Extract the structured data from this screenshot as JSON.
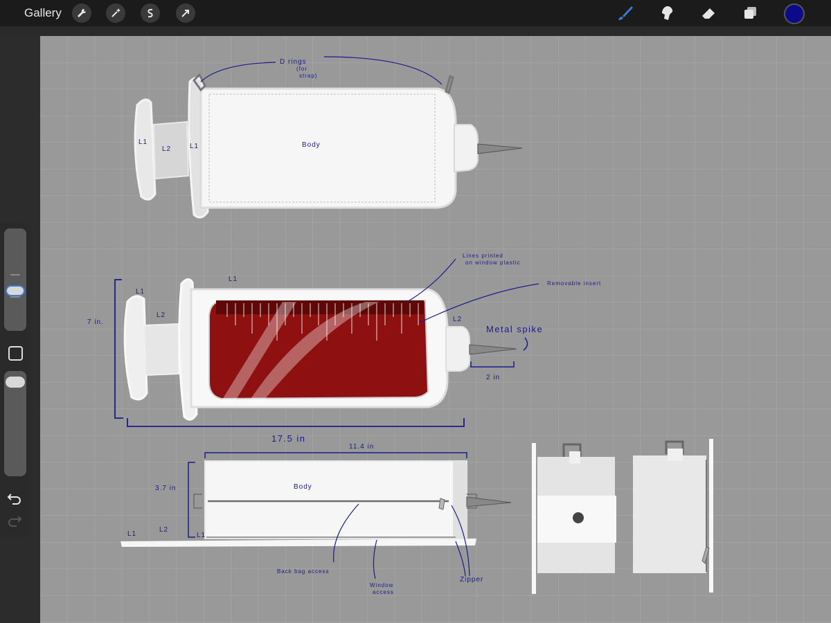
{
  "toolbar": {
    "gallery_label": "Gallery",
    "left_tools": [
      "wrench-icon",
      "magic-wand-icon",
      "selection-icon",
      "transform-arrow-icon"
    ],
    "right_tools": [
      "brush-icon",
      "smudge-icon",
      "eraser-icon",
      "layers-icon"
    ],
    "brush_active_color": "#3a7bd5",
    "current_color": "#0a0a8a"
  },
  "canvas": {
    "background": "#999999",
    "grid_color": "#a8a8a8"
  },
  "drawing": {
    "top_view": {
      "label_d_rings": "D rings",
      "label_d_rings_sub1": "(for",
      "label_d_rings_sub2": "strap)",
      "label_body": "Body",
      "label_l1_a": "L1",
      "label_l2": "L2",
      "label_l1_b": "L1"
    },
    "middle_view": {
      "label_l1_top": "L1",
      "label_l1": "L1",
      "label_l2_left": "L2",
      "label_l2_right": "L2",
      "label_lines_1": "Lines printed",
      "label_lines_2": "on window plastic",
      "label_insert": "Removable insert",
      "label_metal_spike": "Metal spike",
      "dim_height": "7 in.",
      "dim_length": "17.5 in",
      "dim_spike": "2 in",
      "fluid_color": "#8e1010"
    },
    "bottom_view": {
      "dim_width": "11.4 in",
      "dim_height": "3.7 in",
      "label_body": "Body",
      "label_l1_a": "L1",
      "label_l2": "L2",
      "label_l1_b": "L1",
      "label_back_bag": "Back bag access",
      "label_window_1": "Window",
      "label_window_2": "access",
      "label_zipper": "Zipper"
    }
  },
  "sidebar": {
    "modify_label": "",
    "undo_icon": "undo-icon",
    "redo_icon": "redo-icon"
  }
}
